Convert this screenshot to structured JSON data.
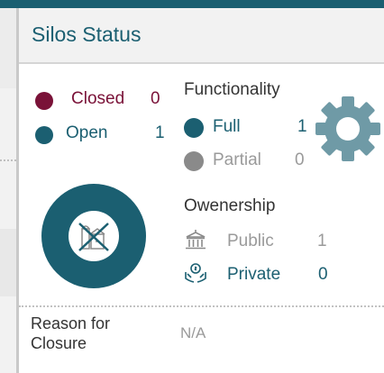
{
  "header": {
    "title": "Silos Status"
  },
  "status": {
    "closed": {
      "label": "Closed",
      "count": "0"
    },
    "open": {
      "label": "Open",
      "count": "1"
    }
  },
  "functionality": {
    "title": "Functionality",
    "full": {
      "label": "Full",
      "count": "1"
    },
    "partial": {
      "label": "Partial",
      "count": "0"
    }
  },
  "ownership": {
    "title": "Owenership",
    "public": {
      "label": "Public",
      "count": "1"
    },
    "private": {
      "label": "Private",
      "count": "0"
    }
  },
  "reason": {
    "label": "Reason for Closure",
    "value": "N/A"
  },
  "icons": {
    "gear": "gear-icon",
    "silo": "silo-closed-icon",
    "public": "public-building-icon",
    "private": "private-hands-icon"
  },
  "colors": {
    "teal": "#1b5f71",
    "maroon": "#7a1238",
    "gray": "#8a8a8a",
    "gear": "#6f9aa6"
  }
}
